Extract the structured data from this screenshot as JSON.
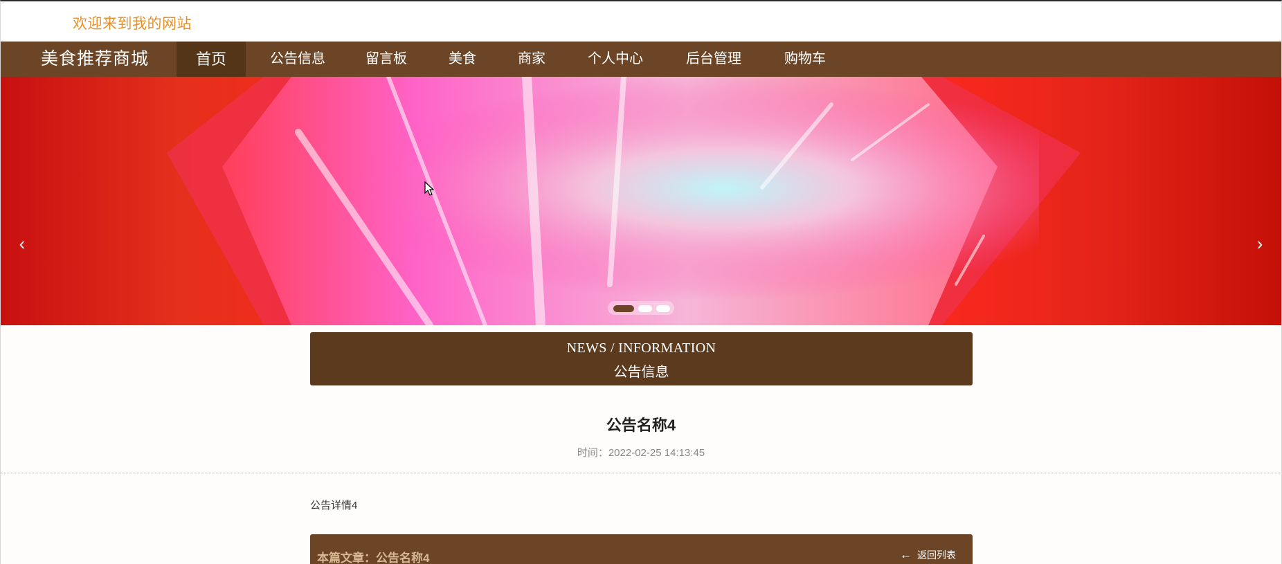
{
  "header": {
    "welcome_text": "欢迎来到我的网站"
  },
  "nav": {
    "brand": "美食推荐商城",
    "items": [
      {
        "label": "首页",
        "active": true
      },
      {
        "label": "公告信息"
      },
      {
        "label": "留言板"
      },
      {
        "label": "美食"
      },
      {
        "label": "商家"
      },
      {
        "label": "个人中心"
      },
      {
        "label": "后台管理"
      },
      {
        "label": "购物车"
      }
    ]
  },
  "banner": {
    "prev_icon": "chevron-left-icon",
    "next_icon": "chevron-right-icon",
    "slide_count": 3,
    "active_slide": 1
  },
  "section": {
    "title_en": "NEWS / INFORMATION",
    "title_cn": "公告信息"
  },
  "article": {
    "title": "公告名称4",
    "meta": "时间：2022-02-25 14:13:45",
    "body": "公告详情4"
  },
  "footer": {
    "current_label": "本篇文章：公告名称4",
    "back_label": "返回列表"
  },
  "colors": {
    "nav_bg": "#6b4526",
    "section_bg": "#5b3a1e",
    "welcome_text": "#e8912b"
  }
}
